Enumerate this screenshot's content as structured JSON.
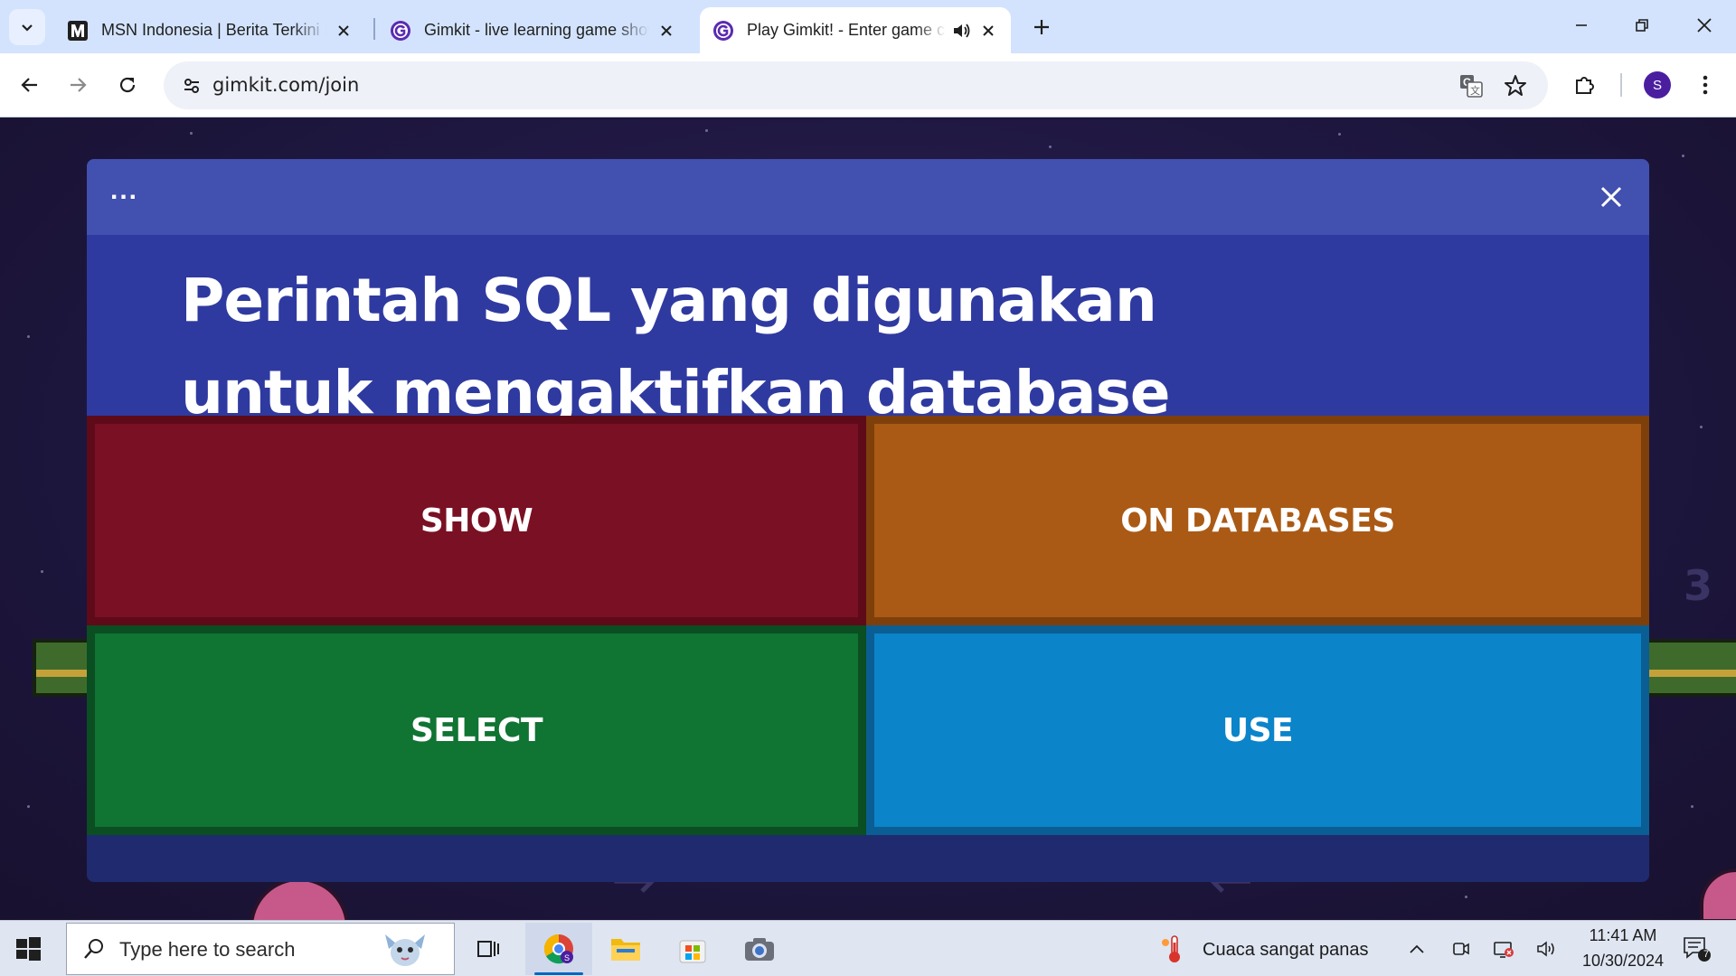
{
  "browser": {
    "tabs": [
      {
        "title": "MSN Indonesia | Berita Terkini Hari Ini",
        "active": false
      },
      {
        "title": "Gimkit - live learning game show",
        "active": false
      },
      {
        "title": "Play Gimkit! - Enter game code",
        "active": true
      }
    ],
    "url": "gimkit.com/join",
    "profile_initial": "S"
  },
  "modal": {
    "menu_dots": "...",
    "question": "Perintah SQL yang digunakan untuk mengaktifkan database adalah...",
    "answers": [
      "SHOW",
      "ON DATABASES",
      "SELECT",
      "USE"
    ],
    "colors": {
      "answer1": "#7a1023",
      "answer2": "#aa5a15",
      "answer3": "#107433",
      "answer4": "#0b84c9"
    }
  },
  "page_decor": {
    "side_number": "3"
  },
  "taskbar": {
    "search_placeholder": "Type here to search",
    "weather": "Cuaca sangat panas",
    "time": "11:41 AM",
    "date": "10/30/2024",
    "notification_count": "7"
  }
}
